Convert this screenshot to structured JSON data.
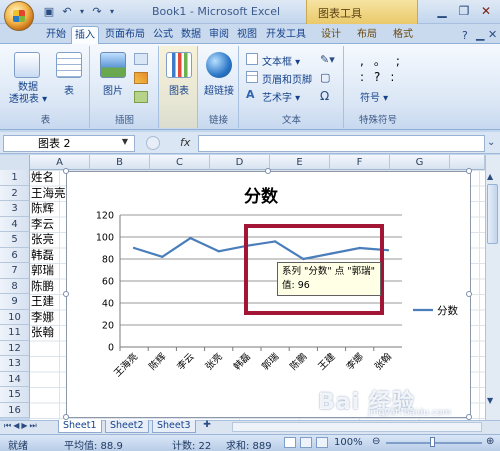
{
  "window": {
    "title": "Book1 - Microsoft Excel",
    "context_tab_group": "图表工具"
  },
  "tabs": [
    {
      "label": "开始"
    },
    {
      "label": "插入"
    },
    {
      "label": "页面布局"
    },
    {
      "label": "公式"
    },
    {
      "label": "数据"
    },
    {
      "label": "审阅"
    },
    {
      "label": "视图"
    },
    {
      "label": "开发工具"
    },
    {
      "label": "设计"
    },
    {
      "label": "布局"
    },
    {
      "label": "格式"
    }
  ],
  "ribbon": {
    "pivot_label": "数据\n透视表 ▾",
    "table_label": "表",
    "picture_label": "图片",
    "chart_label": "图表",
    "hyperlink_label": "超链接",
    "textbox_label": "文本框 ▾",
    "header_footer_label": "页眉和页脚",
    "wordart_label": "艺术字 ▾",
    "symbol_label": "符号 ▾",
    "groups": {
      "table": "表",
      "illustrations": "插图",
      "links": "链接",
      "text": "文本",
      "special": "特殊符号"
    }
  },
  "formula_bar": {
    "name_box": "图表 2",
    "fx": "fx",
    "value": ""
  },
  "columns": [
    "A",
    "B",
    "C",
    "D",
    "E",
    "F",
    "G"
  ],
  "rows": [
    {
      "num": "1",
      "a": "姓名"
    },
    {
      "num": "2",
      "a": "王海亮"
    },
    {
      "num": "3",
      "a": "陈辉"
    },
    {
      "num": "4",
      "a": "李云"
    },
    {
      "num": "5",
      "a": "张亮"
    },
    {
      "num": "6",
      "a": "韩磊"
    },
    {
      "num": "7",
      "a": "郭瑞"
    },
    {
      "num": "8",
      "a": "陈鹏"
    },
    {
      "num": "9",
      "a": "王建"
    },
    {
      "num": "10",
      "a": "李娜"
    },
    {
      "num": "11",
      "a": "张翰"
    },
    {
      "num": "12",
      "a": ""
    },
    {
      "num": "13",
      "a": ""
    },
    {
      "num": "14",
      "a": ""
    },
    {
      "num": "15",
      "a": ""
    },
    {
      "num": "16",
      "a": ""
    }
  ],
  "chart_data": {
    "type": "line",
    "title": "分数",
    "categories": [
      "王海亮",
      "陈辉",
      "李云",
      "张亮",
      "韩磊",
      "郭瑞",
      "陈鹏",
      "王建",
      "李娜",
      "张翰"
    ],
    "series": [
      {
        "name": "分数",
        "values": [
          90,
          82,
          99,
          87,
          92,
          96,
          80,
          85,
          90,
          88
        ],
        "color": "#4a7ebb"
      }
    ],
    "ylim": [
      0,
      120
    ],
    "yticks": [
      "0",
      "20",
      "40",
      "60",
      "80",
      "100",
      "120"
    ],
    "grid": true,
    "legend": "right"
  },
  "tooltip": {
    "line1": "系列 \"分数\" 点 \"郭瑞\"",
    "line2": "值: 96"
  },
  "sheets": [
    {
      "label": "Sheet1"
    },
    {
      "label": "Sheet2"
    },
    {
      "label": "Sheet3"
    }
  ],
  "status": {
    "ready": "就绪",
    "average": "平均值: 88.9",
    "count": "计数: 22",
    "sum": "求和: 889",
    "zoom": "100%"
  },
  "watermark": {
    "text": "Bai 经验",
    "sub": "jingyan.baidu.com"
  }
}
